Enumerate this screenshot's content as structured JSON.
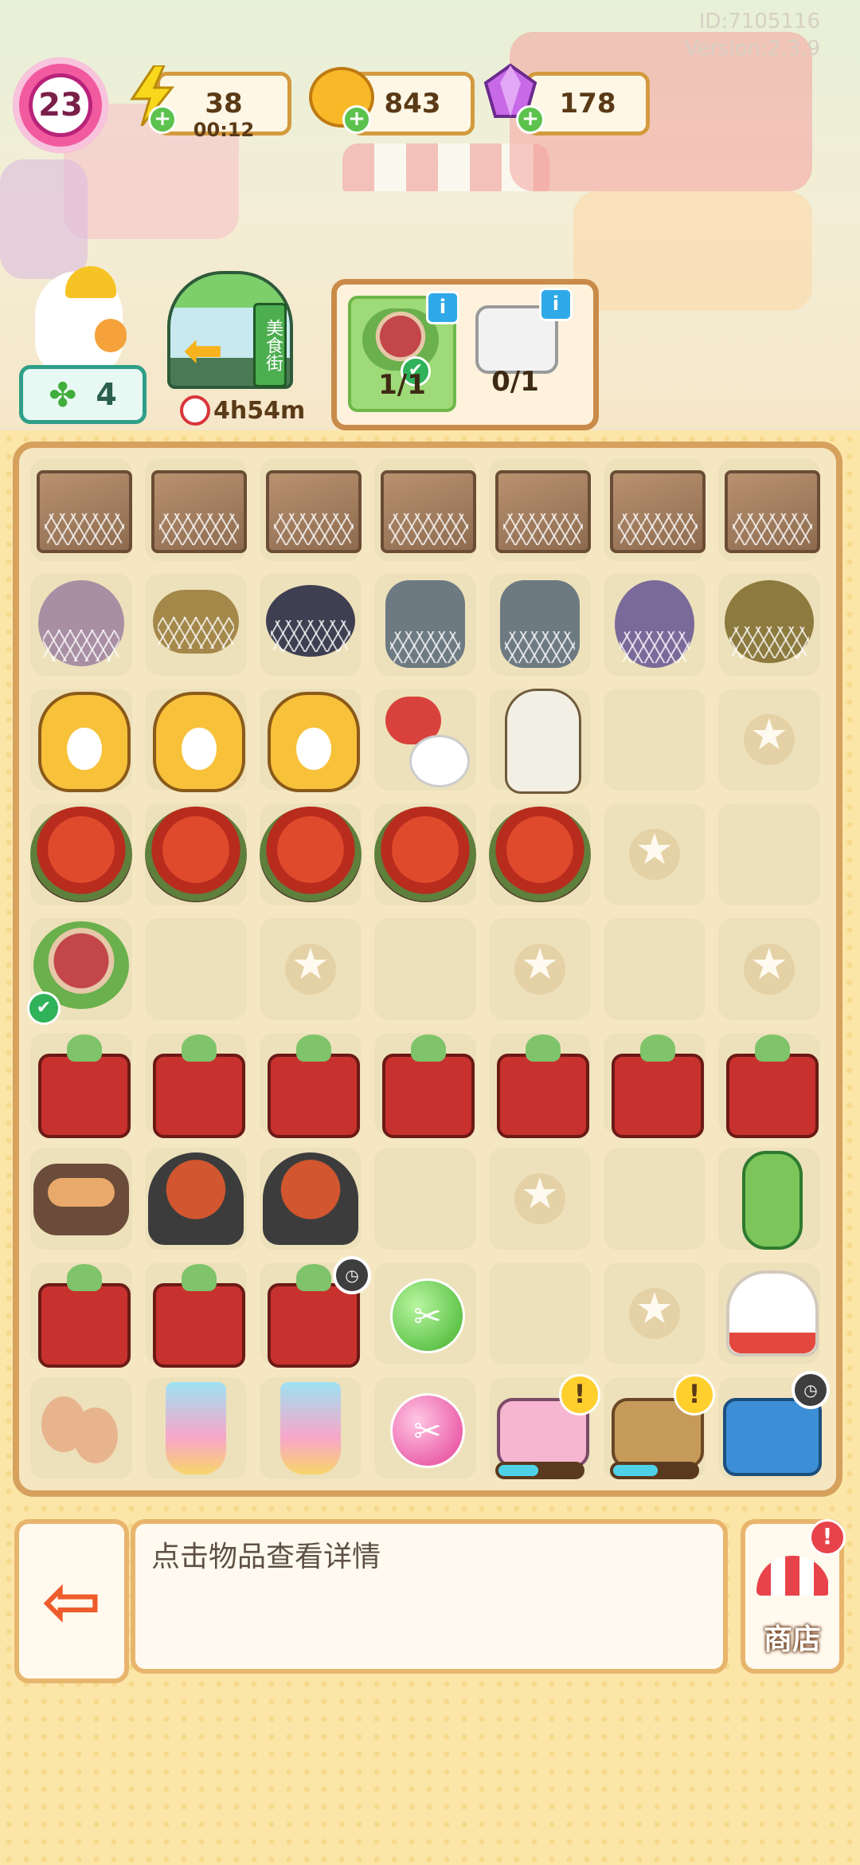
{
  "meta": {
    "player_id": "ID:7105116",
    "version": "Version:2.3.9"
  },
  "hud": {
    "level": "23",
    "energy": {
      "value": "38",
      "timer": "00:12",
      "icon": "lightning-icon"
    },
    "coins": {
      "value": "843",
      "icon": "coin-icon"
    },
    "gems": {
      "value": "178",
      "icon": "gem-icon"
    }
  },
  "worker": {
    "clovers": "4"
  },
  "event": {
    "name": "美食街",
    "timer": "4h54m"
  },
  "orders": [
    {
      "progress": "1/1",
      "status": "done",
      "icon": "steak-platter-icon"
    },
    {
      "progress": "0/1",
      "status": "pending",
      "icon": "takeout-box-icon"
    }
  ],
  "board": {
    "progress_bars": {
      "pink_cart": 0.45,
      "food_cart": 0.5
    }
  },
  "bottom": {
    "hint_text": "点击物品查看详情",
    "shop_label": "商店",
    "shop_notification": "!"
  },
  "colors": {
    "accent_pink": "#f25aa0",
    "frame_brown": "#d6a05d",
    "positive_green": "#5cc24e"
  }
}
